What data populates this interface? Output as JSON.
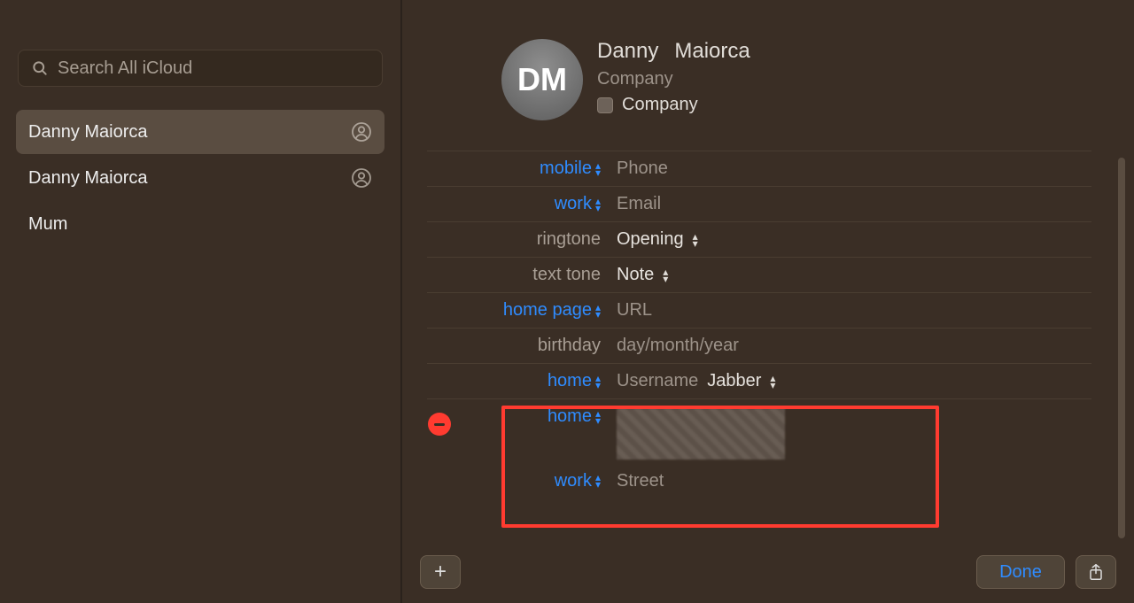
{
  "search": {
    "placeholder": "Search All iCloud"
  },
  "contacts": [
    {
      "name": "Danny  Maiorca",
      "hasIcon": true,
      "selected": true
    },
    {
      "name": "Danny Maiorca",
      "hasIcon": true,
      "selected": false
    },
    {
      "name": "Mum",
      "hasIcon": false,
      "selected": false
    }
  ],
  "card": {
    "initials": "DM",
    "first": "Danny",
    "last": "Maiorca",
    "company_placeholder": "Company",
    "company_checkbox_label": "Company"
  },
  "fields": {
    "mobile_label": "mobile",
    "mobile_value_placeholder": "Phone",
    "work_email_label": "work",
    "work_email_placeholder": "Email",
    "ringtone_label": "ringtone",
    "ringtone_value": "Opening",
    "texttone_label": "text tone",
    "texttone_value": "Note",
    "homepage_label": "home page",
    "homepage_placeholder": "URL",
    "birthday_label": "birthday",
    "birthday_placeholder": "day/month/year",
    "username_home_label": "home",
    "username_placeholder": "Username",
    "username_service": "Jabber",
    "address_home_label": "home",
    "address_work_label": "work",
    "address_work_placeholder": "Street"
  },
  "buttons": {
    "add": "+",
    "done": "Done",
    "share_icon": "share-icon"
  }
}
